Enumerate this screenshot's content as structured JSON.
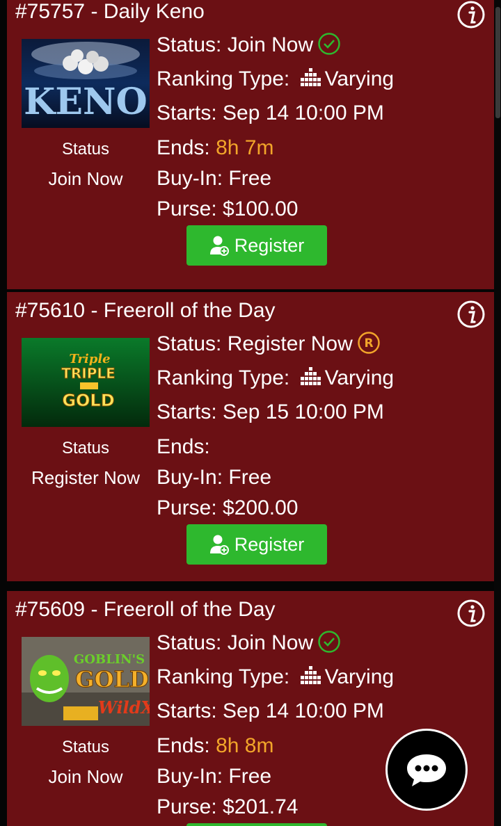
{
  "labels": {
    "status_prefix": "Status: ",
    "ranking_prefix": "Ranking Type: ",
    "starts_prefix": "Starts: ",
    "ends_prefix": "Ends: ",
    "buyin_prefix": "Buy-In: ",
    "purse_prefix": "Purse: ",
    "left_status_label": "Status",
    "register_button": "Register"
  },
  "colors": {
    "card_bg": "#6b1014",
    "accent_green": "#2eb82e",
    "highlight_orange": "#f2a52a"
  },
  "tournaments": [
    {
      "title": "#75757 - Daily Keno",
      "status": "Join Now",
      "status_icon": "check-circle-icon",
      "ranking_type": "Varying",
      "starts": "Sep 14 10:00 PM",
      "ends": "8h 7m",
      "buy_in": "Free",
      "purse": "$100.00",
      "game_logo_text": "KENO"
    },
    {
      "title": "#75610 - Freeroll of the Day",
      "status": "Register Now",
      "status_icon": "registered-circle-icon",
      "ranking_type": "Varying",
      "starts": "Sep 15 10:00 PM",
      "ends": "",
      "buy_in": "Free",
      "purse": "$200.00",
      "game_logo_text": [
        "Triple",
        "TRIPLE",
        "GOLD"
      ]
    },
    {
      "title": "#75609 - Freeroll of the Day",
      "status": "Join Now",
      "status_icon": "check-circle-icon",
      "ranking_type": "Varying",
      "starts": "Sep 14 10:00 PM",
      "ends": "8h 8m",
      "buy_in": "Free",
      "purse": "$201.74",
      "game_logo_text": [
        "GOBLIN'S",
        "GOLD",
        "WildX"
      ]
    }
  ]
}
